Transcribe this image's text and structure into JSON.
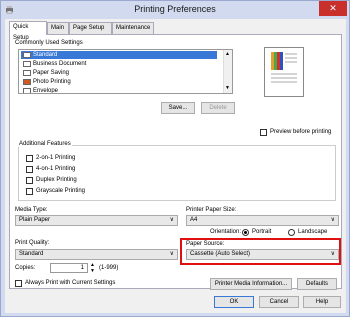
{
  "window": {
    "title": "Printing Preferences",
    "close": "✕"
  },
  "tabs": [
    "Quick Setup",
    "Main",
    "Page Setup",
    "Maintenance"
  ],
  "common_settings": {
    "label": "Commonly Used Settings",
    "items": [
      "Standard",
      "Business Document",
      "Paper Saving",
      "Photo Printing",
      "Envelope"
    ],
    "selected_index": 0,
    "save_label": "Save...",
    "delete_label": "Delete"
  },
  "preview": {
    "checkbox_label": "Preview before printing"
  },
  "additional": {
    "label": "Additional Features",
    "items": [
      "2-on-1 Printing",
      "4-on-1 Printing",
      "Duplex Printing",
      "Grayscale Printing"
    ]
  },
  "media_type": {
    "label": "Media Type:",
    "value": "Plain Paper"
  },
  "printer_paper_size": {
    "label": "Printer Paper Size:",
    "value": "A4"
  },
  "orientation": {
    "label": "Orientation:",
    "portrait": "Portrait",
    "landscape": "Landscape",
    "selected": "Portrait"
  },
  "print_quality": {
    "label": "Print Quality:",
    "value": "Standard"
  },
  "paper_source": {
    "label": "Paper Source:",
    "value": "Cassette (Auto Select)"
  },
  "copies": {
    "label": "Copies:",
    "value": "1",
    "range": "(1-999)"
  },
  "always_print": {
    "label": "Always Print with Current Settings"
  },
  "buttons": {
    "media_info": "Printer Media Information...",
    "defaults": "Defaults",
    "ok": "OK",
    "cancel": "Cancel",
    "help": "Help"
  },
  "colors": {
    "highlight": "#e01010",
    "selection": "#3978d6",
    "close": "#c9302c"
  }
}
